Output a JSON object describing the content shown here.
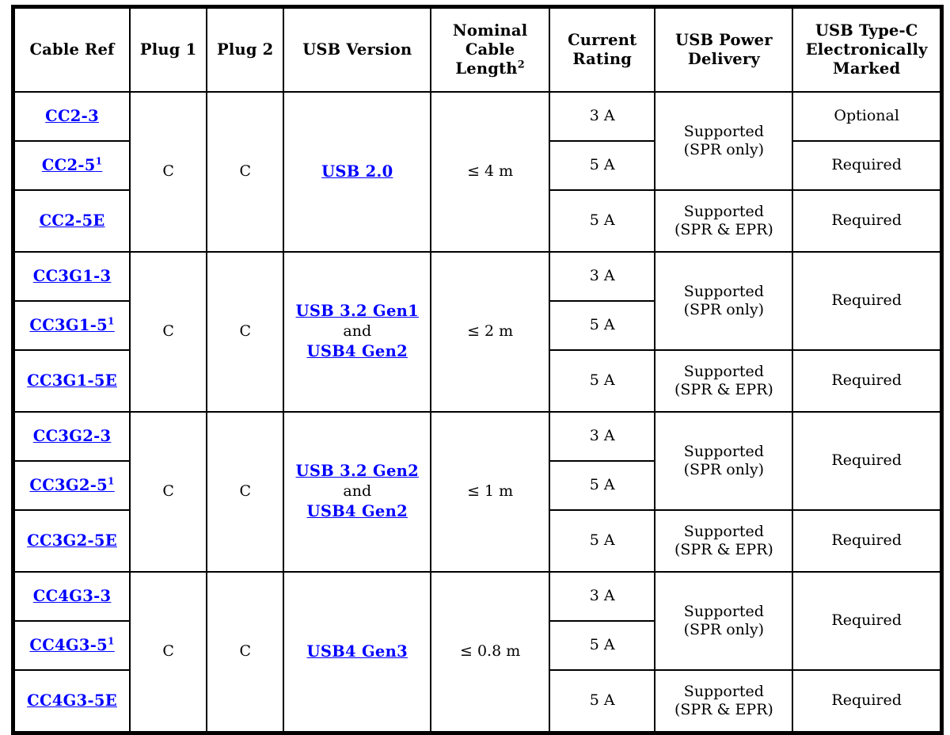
{
  "table": {
    "headers": [
      "Cable Ref",
      "Plug 1",
      "Plug 2",
      "USB Version",
      "Nominal Cable Length",
      "Current Rating",
      "USB Power Delivery",
      "USB Type-C Electronically Marked"
    ],
    "header_length_lines": [
      "Nominal",
      "Cable",
      "Length"
    ],
    "header_length_superscript": "2",
    "header_current_lines": [
      "Current",
      "Rating"
    ],
    "header_pd_lines": [
      "USB Power",
      "Delivery"
    ],
    "header_em_lines": [
      "USB Type-C",
      "Electronically",
      "Marked"
    ],
    "groups": [
      {
        "plug1": "C",
        "plug2": "C",
        "version_lines": [
          {
            "text": "USB 2.0",
            "link": true
          }
        ],
        "length": "≤ 4 m",
        "refs": [
          {
            "label": "CC2-3",
            "sup": "",
            "link": true
          },
          {
            "label": "CC2-5",
            "sup": "1",
            "link": true
          },
          {
            "label": "CC2-5E",
            "sup": "",
            "link": true
          }
        ],
        "current": [
          "3 A",
          "5 A",
          "5 A"
        ],
        "pd_top": {
          "line1": "Supported",
          "line2": "(SPR only)"
        },
        "pd_bottom": {
          "line1": "Supported",
          "line2": "(SPR & EPR)"
        },
        "em_merged_top": false,
        "em": [
          "Optional",
          "Required",
          "Required"
        ]
      },
      {
        "plug1": "C",
        "plug2": "C",
        "version_lines": [
          {
            "text": "USB 3.2 Gen1",
            "link": true
          },
          {
            "text": "and",
            "link": false
          },
          {
            "text": "USB4 Gen2",
            "link": true
          }
        ],
        "length": "≤ 2 m",
        "refs": [
          {
            "label": "CC3G1-3",
            "sup": "",
            "link": true
          },
          {
            "label": "CC3G1-5",
            "sup": "1",
            "link": true
          },
          {
            "label": "CC3G1-5E",
            "sup": "",
            "link": true
          }
        ],
        "current": [
          "3 A",
          "5 A",
          "5 A"
        ],
        "pd_top": {
          "line1": "Supported",
          "line2": "(SPR only)"
        },
        "pd_bottom": {
          "line1": "Supported",
          "line2": "(SPR & EPR)"
        },
        "em_merged_top": true,
        "em": [
          "Required",
          "",
          "Required"
        ]
      },
      {
        "plug1": "C",
        "plug2": "C",
        "version_lines": [
          {
            "text": "USB 3.2 Gen2",
            "link": true
          },
          {
            "text": "and",
            "link": false
          },
          {
            "text": "USB4 Gen2",
            "link": true
          }
        ],
        "length": "≤ 1 m",
        "refs": [
          {
            "label": "CC3G2-3",
            "sup": "",
            "link": true
          },
          {
            "label": "CC3G2-5",
            "sup": "1",
            "link": true
          },
          {
            "label": "CC3G2-5E",
            "sup": "",
            "link": true
          }
        ],
        "current": [
          "3 A",
          "5 A",
          "5 A"
        ],
        "pd_top": {
          "line1": "Supported",
          "line2": "(SPR only)"
        },
        "pd_bottom": {
          "line1": "Supported",
          "line2": "(SPR & EPR)"
        },
        "em_merged_top": true,
        "em": [
          "Required",
          "",
          "Required"
        ]
      },
      {
        "plug1": "C",
        "plug2": "C",
        "version_lines": [
          {
            "text": "USB4 Gen3",
            "link": true
          }
        ],
        "length": "≤ 0.8 m",
        "refs": [
          {
            "label": "CC4G3-3",
            "sup": "",
            "link": true
          },
          {
            "label": "CC4G3-5",
            "sup": "1",
            "link": true
          },
          {
            "label": "CC4G3-5E",
            "sup": "",
            "link": true
          }
        ],
        "current": [
          "3 A",
          "5 A",
          "5 A"
        ],
        "pd_top": {
          "line1": "Supported",
          "line2": "(SPR only)"
        },
        "pd_bottom": {
          "line1": "Supported",
          "line2": "(SPR & EPR)"
        },
        "em_merged_top": true,
        "em": [
          "Required",
          "",
          "Required"
        ]
      }
    ]
  },
  "colors": {
    "link": "#0000FF",
    "border": "#000000",
    "text": "#000000",
    "background": "#FFFFFF"
  }
}
